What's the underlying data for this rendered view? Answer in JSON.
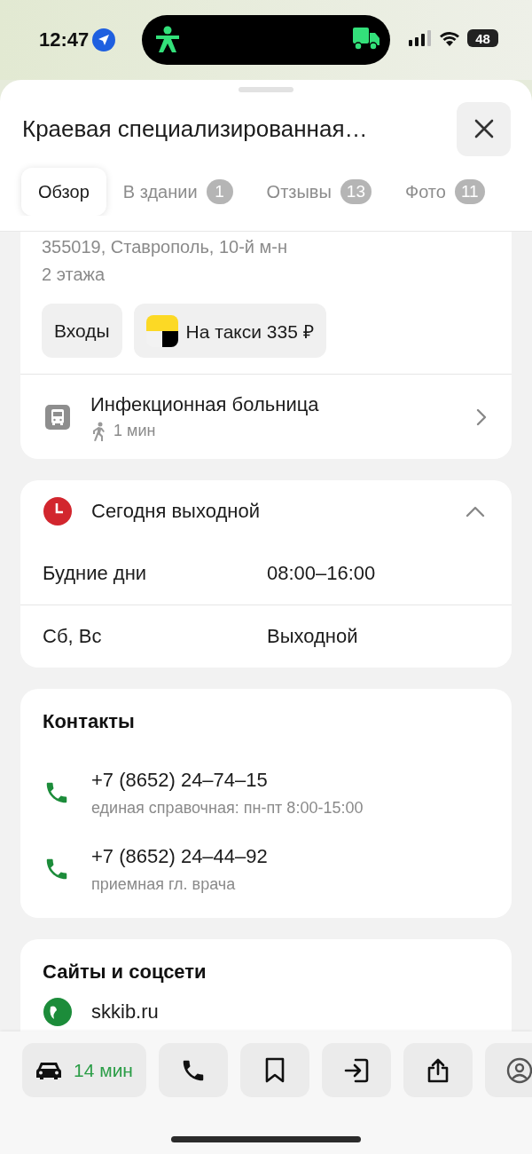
{
  "status_bar": {
    "time": "12:47",
    "battery": "48"
  },
  "header": {
    "title": "Краевая специализированная…"
  },
  "tabs": [
    {
      "label": "Обзор",
      "selected": true
    },
    {
      "label": "В здании",
      "count": "1",
      "selected": false
    },
    {
      "label": "Отзывы",
      "count": "13",
      "selected": false
    },
    {
      "label": "Фото",
      "count": "11",
      "selected": false
    }
  ],
  "address": {
    "line": "355019, Ставрополь, 10-й м-н",
    "floors": "2 этажа"
  },
  "actions": [
    {
      "kind": "plain",
      "label": "Входы"
    },
    {
      "kind": "taxi",
      "label": "На такси 335 ₽"
    }
  ],
  "transit": {
    "stop": "Инфекционная больница",
    "walk": "1 мин"
  },
  "hours": {
    "status": "Сегодня выходной",
    "expanded": true,
    "rows": [
      {
        "days": "Будние дни",
        "time": "08:00–16:00"
      },
      {
        "days": "Сб, Вс",
        "time": "Выходной"
      }
    ]
  },
  "contacts": {
    "title": "Контакты",
    "phones": [
      {
        "number": "+7 (8652) 24–74–15",
        "note": "единая справочная: пн-пт 8:00-15:00"
      },
      {
        "number": "+7 (8652) 24–44–92",
        "note": "приемная гл. врача"
      }
    ]
  },
  "sites": {
    "title": "Сайты и соцсети",
    "links": [
      "skkib.ru"
    ]
  },
  "bottom_bar": {
    "route": {
      "time": "14 мин"
    },
    "buttons": [
      {
        "kind": "phone"
      },
      {
        "kind": "bookmark"
      },
      {
        "kind": "enter"
      },
      {
        "kind": "share"
      },
      {
        "kind": "profile"
      }
    ]
  }
}
